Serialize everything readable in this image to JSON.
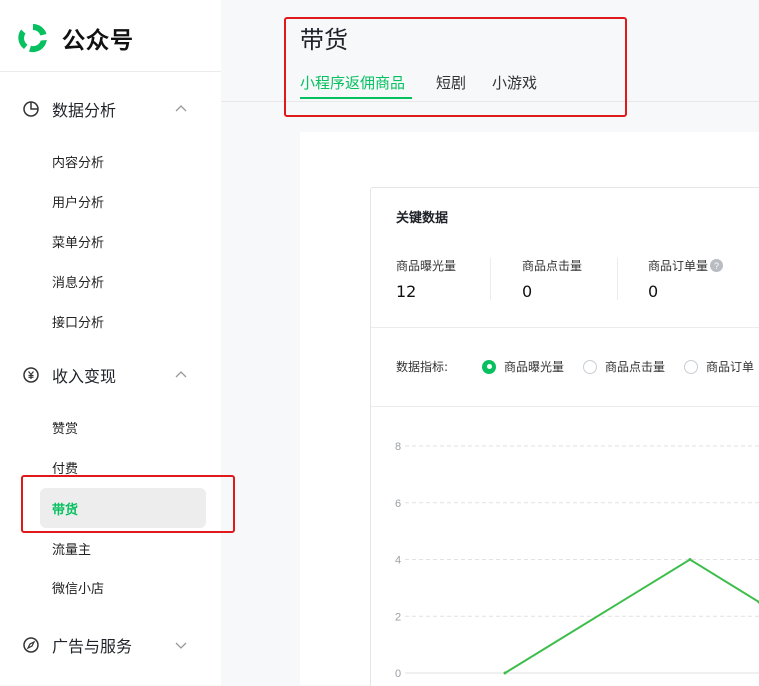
{
  "app": {
    "title": "公众号"
  },
  "sidebar": {
    "groups": [
      {
        "label": "数据分析",
        "icon": "pie-chart-icon",
        "items": [
          "内容分析",
          "用户分析",
          "菜单分析",
          "消息分析",
          "接口分析"
        ]
      },
      {
        "label": "收入变现",
        "icon": "yuan-icon",
        "items": [
          "赞赏",
          "付费",
          "带货",
          "流量主",
          "微信小店"
        ]
      },
      {
        "label": "广告与服务",
        "icon": "compass-icon",
        "items": []
      }
    ],
    "active_item": "带货"
  },
  "header": {
    "title": "带货",
    "tabs": [
      "小程序返佣商品",
      "短剧",
      "小游戏"
    ],
    "active_tab": "小程序返佣商品"
  },
  "key_data": {
    "title": "关键数据",
    "metrics": [
      {
        "label": "商品曝光量",
        "value": "12"
      },
      {
        "label": "商品点击量",
        "value": "0"
      },
      {
        "label": "商品订单量",
        "value": "0"
      }
    ]
  },
  "indicator": {
    "label": "数据指标:",
    "options": [
      "商品曝光量",
      "商品点击量",
      "商品订单"
    ],
    "selected": "商品曝光量"
  },
  "colors": {
    "accent": "#07c160",
    "line": "#3dbd4a",
    "highlight_box": "#e0191b"
  },
  "chart_data": {
    "type": "line",
    "y_ticks": [
      "8",
      "6",
      "4",
      "2",
      "0"
    ],
    "ylim": [
      0,
      8
    ],
    "series": [
      {
        "values": [
          0,
          4,
          2.5
        ]
      }
    ],
    "grid": true
  }
}
